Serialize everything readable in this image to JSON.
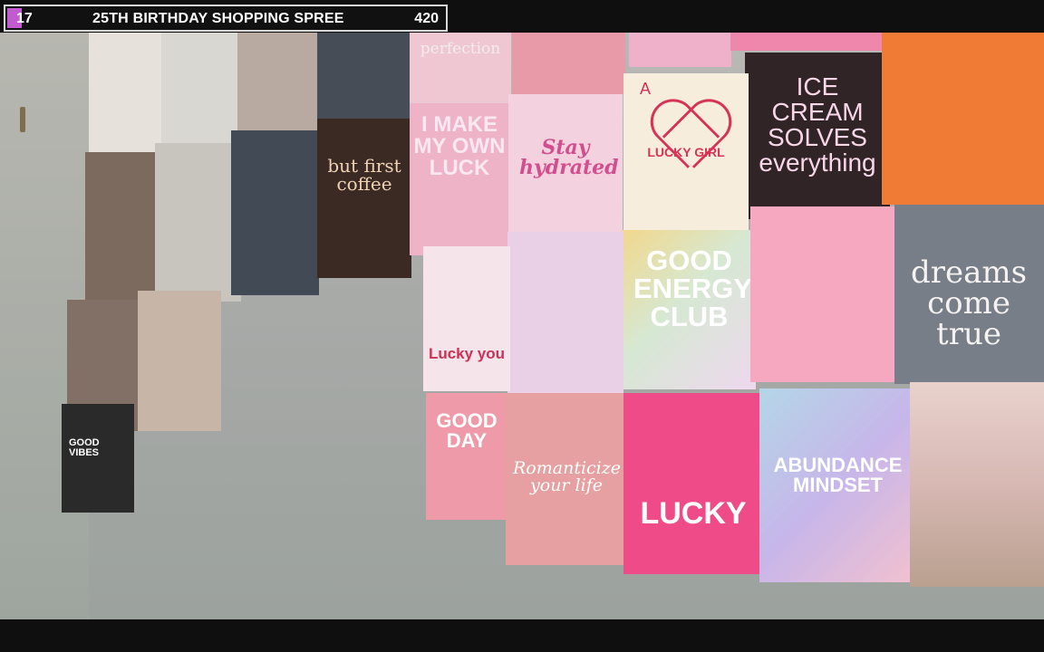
{
  "overlay": {
    "left_value": "17",
    "title": "25TH BIRTHDAY SHOPPING SPREE",
    "right_value": "420",
    "accent_color": "#c25bd0"
  },
  "posters": {
    "perfection": "perfection",
    "ice_cream": "ICE CREAM SOLVES everything",
    "stay_hydrated": "Stay hydrated",
    "lucky_girl": "LUCKY GIRL",
    "card_a": "A",
    "i_make_my_own_luck": "I MAKE MY OWN LUCK",
    "but_first_coffee": "but first coffee",
    "good_energy_club": "GOOD ENERGY CLUB",
    "dreams_come_true": "dreams come true",
    "good_vibes": "GOOD VIBES",
    "good_day": "GOOD DAY",
    "romanticize": "Romanticize your life",
    "lucky": "LUCKY",
    "abundance": "ABUNDANCE MINDSET",
    "luck_card": "Lucky you"
  }
}
